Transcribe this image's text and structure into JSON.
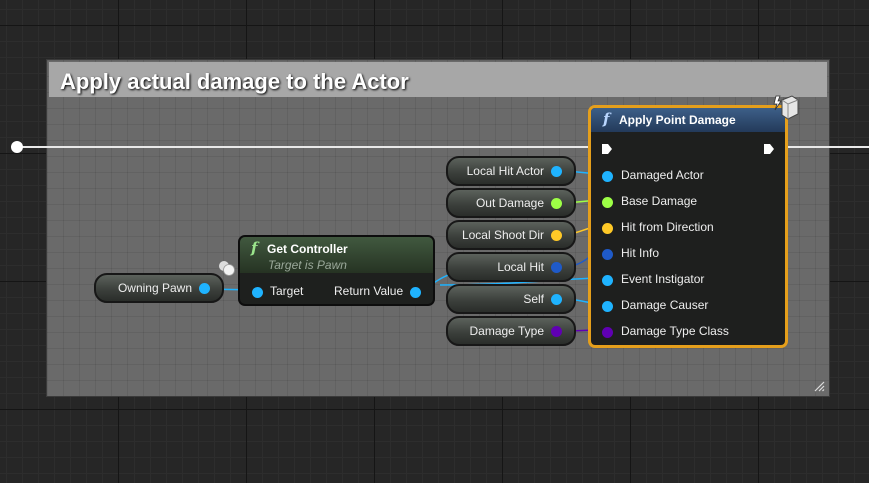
{
  "comment": {
    "title": "Apply actual damage to the Actor"
  },
  "nodes": {
    "owning_pawn": {
      "label": "Owning Pawn",
      "pin_color": "#1fb3ff"
    },
    "get_controller": {
      "title": "Get Controller",
      "subtitle": "Target is Pawn",
      "input_pin": "Target",
      "output_pin": "Return Value",
      "icon": "function-icon"
    },
    "variables": [
      {
        "label": "Local Hit Actor",
        "pin_color": "#1fb3ff",
        "pin_type": "object"
      },
      {
        "label": "Out Damage",
        "pin_color": "#9dff46",
        "pin_type": "float"
      },
      {
        "label": "Local Shoot Dir",
        "pin_color": "#ffc927",
        "pin_type": "vector"
      },
      {
        "label": "Local Hit",
        "pin_color": "#1f5ac8",
        "pin_type": "struct"
      },
      {
        "label": "Self",
        "pin_color": "#1fb3ff",
        "pin_type": "object"
      },
      {
        "label": "Damage Type",
        "pin_color": "#6000b3",
        "pin_type": "class"
      }
    ],
    "apply_point_damage": {
      "title": "Apply Point Damage",
      "icon": "function-icon",
      "authority_icon": "authority-only-icon",
      "pins": [
        {
          "label": "Damaged Actor",
          "pin_color": "#1fb3ff"
        },
        {
          "label": "Base Damage",
          "pin_color": "#9dff46"
        },
        {
          "label": "Hit from Direction",
          "pin_color": "#ffc927"
        },
        {
          "label": "Hit Info",
          "pin_color": "#1f5ac8"
        },
        {
          "label": "Event Instigator",
          "pin_color": "#1fb3ff"
        },
        {
          "label": "Damage Causer",
          "pin_color": "#1fb3ff"
        },
        {
          "label": "Damage Type Class",
          "pin_color": "#6000b3"
        }
      ],
      "border_color": "#e59f1c"
    }
  }
}
